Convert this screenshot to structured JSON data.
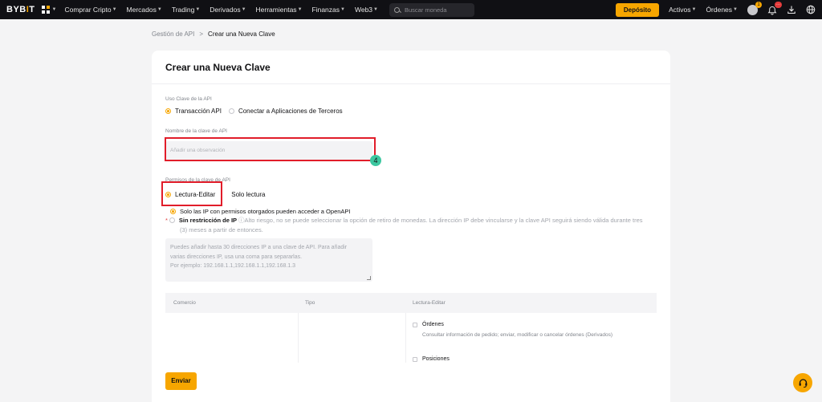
{
  "topbar": {
    "logo": "BYBIT",
    "nav": [
      "Comprar Cripto",
      "Mercados",
      "Trading",
      "Derivados",
      "Herramientas",
      "Finanzas",
      "Web3"
    ],
    "search_placeholder": "Buscar moneda",
    "deposit_label": "Depósito",
    "assets_label": "Activos",
    "orders_label": "Órdenes",
    "avatar_badge": "1",
    "bell_badge": "···"
  },
  "breadcrumb": {
    "parent": "Gestión de API",
    "separator": ">",
    "current": "Crear una Nueva Clave"
  },
  "form": {
    "title": "Crear una Nueva Clave",
    "usage_label": "Uso Clave de la API",
    "usage_options": [
      "Transacción API",
      "Conectar a Aplicaciones de Terceros"
    ],
    "name_label": "Nombre de la clave de API",
    "name_placeholder": "Añadir una observación",
    "step_number": "4",
    "permissions_label": "Permisos de la clave de API",
    "permission_options": [
      "Lectura-Editar",
      "Solo lectura"
    ],
    "ip_option_1": "Solo las IP con permisos otorgados pueden acceder a OpenAPI",
    "ip_option_2": "Sin restricción de IP",
    "ip_option_2_note": "ⓘAlto riesgo, no se puede seleccionar la opción de retiro de monedas. La dirección IP debe vincularse y la clave API seguirá siendo válida durante tres",
    "ip_option_2_note_cont": "(3) meses a partir de entonces.",
    "ip_textarea_lines": [
      "Puedes añadir hasta 30 direcciones IP a una clave de API. Para añadir",
      "varias direcciones IP, usa una coma para separarlas.",
      "Por ejemplo: 192.168.1.1,192.168.1.1,192.168.1.3"
    ],
    "table_headers": [
      "Comercio",
      "Tipo",
      "Lectura-Editar"
    ],
    "perm_items": [
      {
        "label": "Órdenes",
        "desc": "Consultar información de pedido; enviar, modificar o cancelar órdenes (Derivados)"
      },
      {
        "label": "Posiciones"
      }
    ],
    "submit_label": "Enviar"
  },
  "colors": {
    "accent": "#f7a600",
    "highlight": "#e11d2a",
    "step_badge": "#3cc7a0",
    "topbar": "#101014"
  }
}
